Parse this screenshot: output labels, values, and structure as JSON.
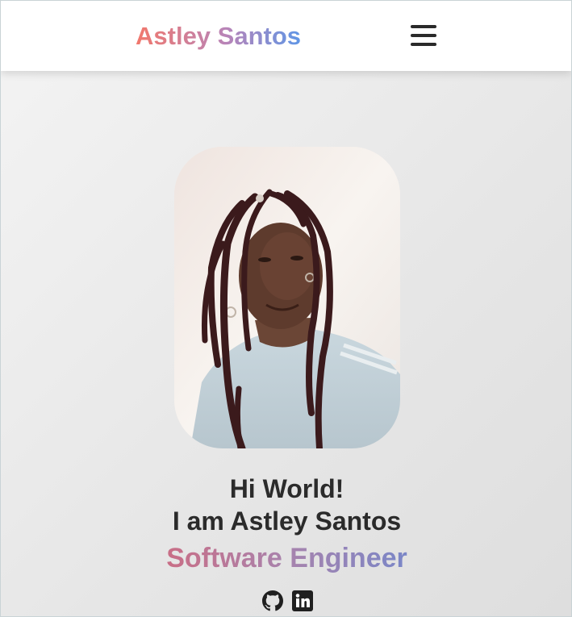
{
  "header": {
    "brand": "Astley Santos",
    "menu_icon": "hamburger-menu-icon"
  },
  "hero": {
    "photo_alt": "Astley Santos",
    "greeting_line1": "Hi World!",
    "greeting_line2": "I am Astley Santos",
    "role": "Software Engineer"
  },
  "socials": [
    {
      "icon": "github-icon"
    },
    {
      "icon": "linkedin-icon"
    }
  ],
  "colors": {
    "brand_gradient": [
      "#f2786c",
      "#b884b8",
      "#5f96e6"
    ],
    "role_gradient": [
      "#c96e86",
      "#a883ad",
      "#7a86c7"
    ],
    "text": "#2b2b2b"
  }
}
